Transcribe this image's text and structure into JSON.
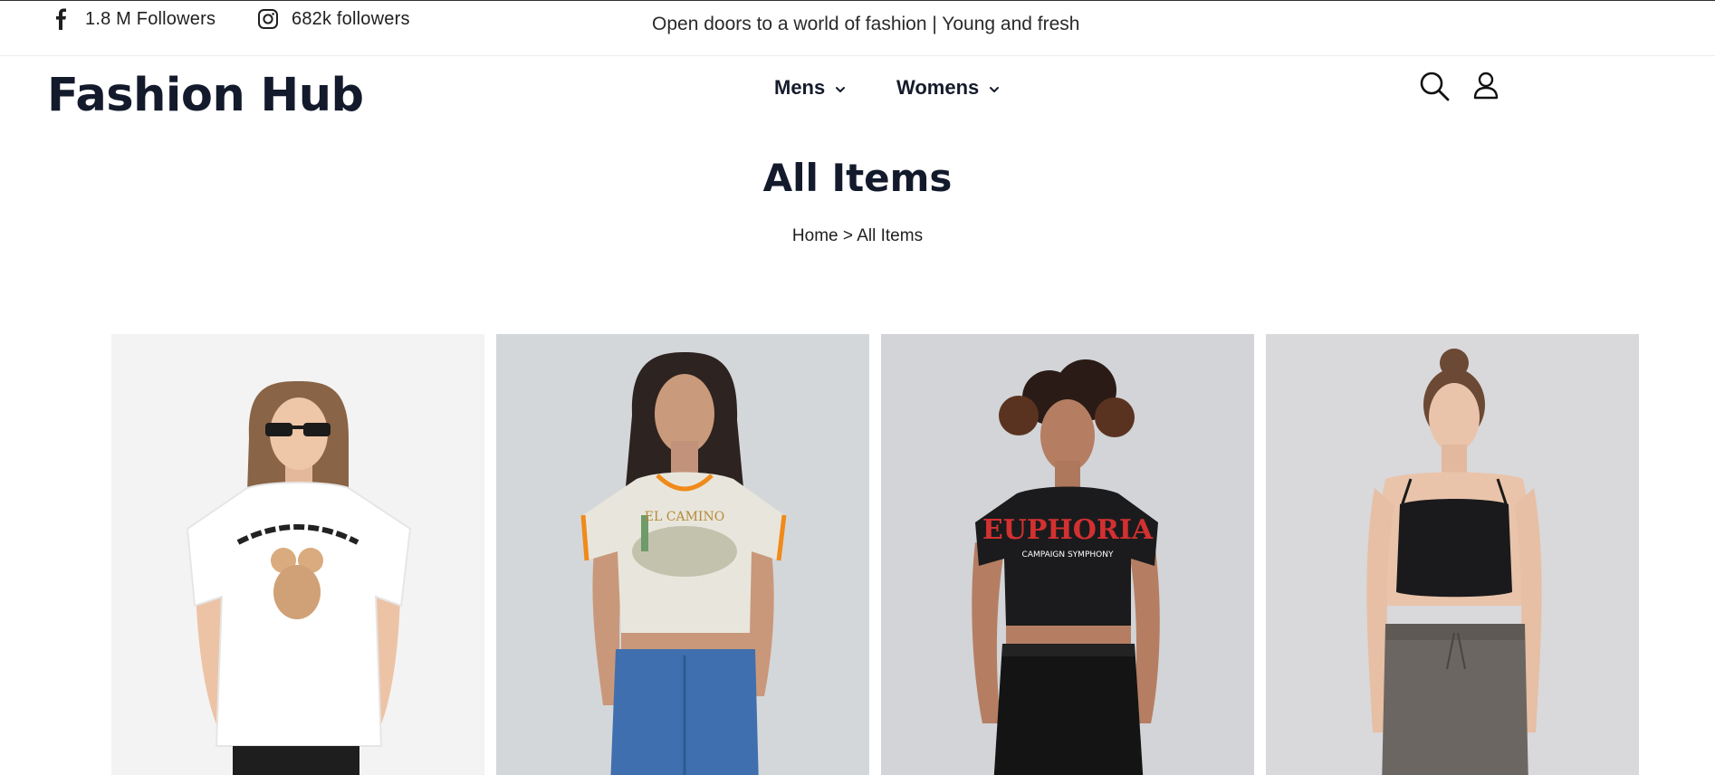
{
  "topbar": {
    "facebook": {
      "icon": "facebook-icon",
      "followers": "1.8 M Followers"
    },
    "instagram": {
      "icon": "instagram-icon",
      "followers": "682k followers"
    },
    "tagline": "Open doors to a world of fashion | Young and fresh"
  },
  "header": {
    "brand": "Fashion Hub",
    "nav": [
      {
        "label": "Mens",
        "icon": "chevron-down-icon"
      },
      {
        "label": "Womens",
        "icon": "chevron-down-icon"
      }
    ],
    "icons": {
      "search": "search-icon",
      "account": "user-icon"
    }
  },
  "page": {
    "title": "All Items",
    "breadcrumb": {
      "home": "Home",
      "separator": ">",
      "current": "All Items"
    }
  },
  "products": [
    {
      "image": "woman in white oversized tee with sunglasses"
    },
    {
      "image": "woman in cream ringer crop tee and jeans"
    },
    {
      "image": "woman in black graphic crop tee and skirt"
    },
    {
      "image": "woman in black cami crop top and grey joggers"
    }
  ],
  "colors": {
    "brand_text": "#131a2c",
    "card_bg_1": "#f3f3f3",
    "card_bg_2": "#d4d7da",
    "card_bg_3": "#d2d4d7",
    "card_bg_4": "#d9d8db"
  }
}
